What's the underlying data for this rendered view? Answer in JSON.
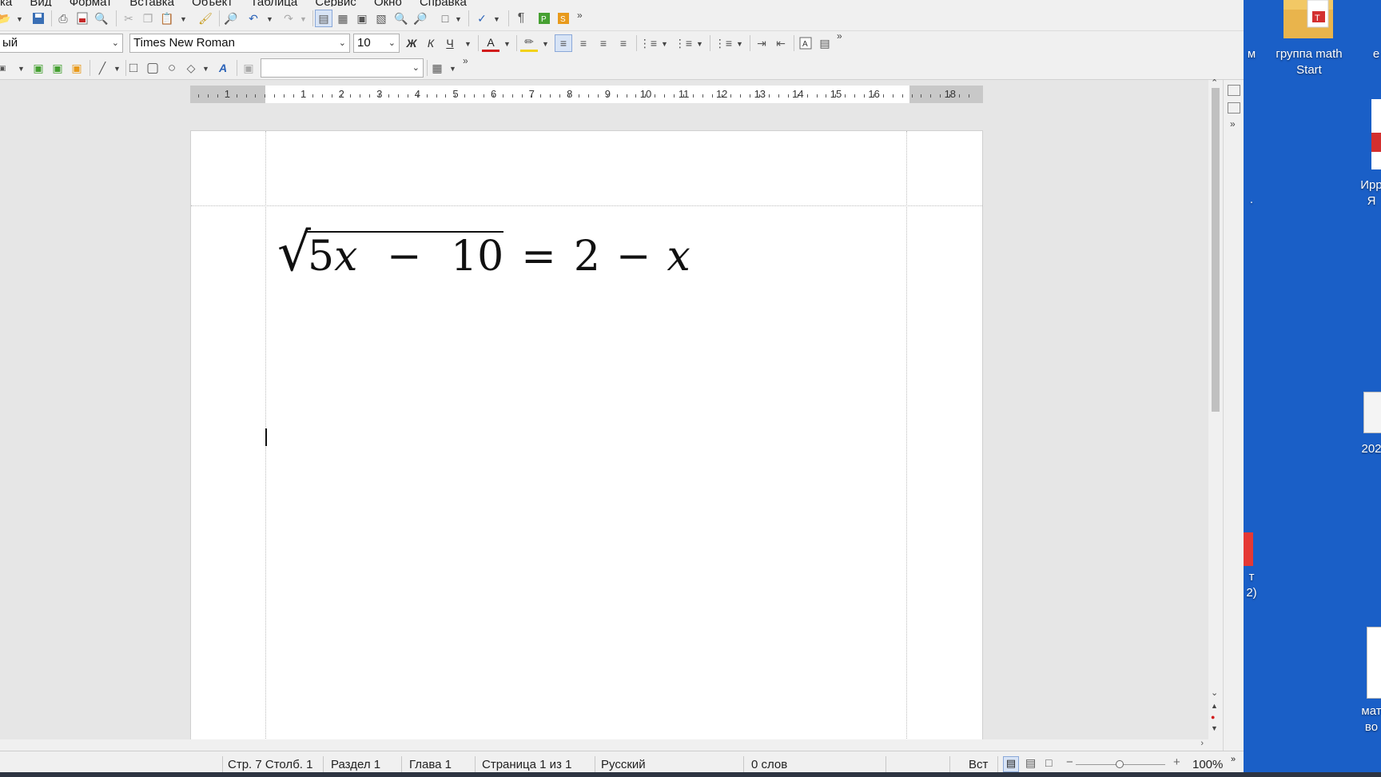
{
  "menubar": {
    "items": [
      "ка",
      "Вид",
      "Формат",
      "Вставка",
      "Объект",
      "Таблица",
      "Сервис",
      "Окно",
      "Справка"
    ]
  },
  "formatting": {
    "paragraph_style": "ый",
    "font_name": "Times New Roman",
    "font_size": "10",
    "bold_label": "Ж",
    "italic_label": "К",
    "underline_label": "Ч"
  },
  "ruler": {
    "labels": [
      "1",
      "1",
      "2",
      "3",
      "4",
      "5",
      "6",
      "7",
      "8",
      "9",
      "10",
      "11",
      "12",
      "13",
      "14",
      "15",
      "16",
      "18"
    ]
  },
  "document": {
    "formula": {
      "radicand_coef": "5",
      "radicand_var": "x",
      "radicand_op": "−",
      "radicand_const": "10",
      "equals": "=",
      "rhs_const": "2",
      "rhs_op": "−",
      "rhs_var": "x"
    }
  },
  "statusbar": {
    "position": "Стр. 7 Столб. 1",
    "section": "Раздел 1",
    "chapter": "Глава 1",
    "page": "Страница 1 из 1",
    "language": "Русский",
    "words": "0 слов",
    "insert_mode": "Вст",
    "zoom": "100%",
    "zoom_level_percent": 100
  },
  "desktop": {
    "icons": [
      {
        "label": "м"
      },
      {
        "label": "группа math Start"
      },
      {
        "label": "е"
      },
      {
        "label": "Ирр Я"
      },
      {
        "label": "."
      },
      {
        "label": "202"
      },
      {
        "label": "т 2)"
      },
      {
        "label": "мат во"
      }
    ]
  },
  "colors": {
    "desktop": "#1a5fc7",
    "toolbar_bg": "#f0f0f0",
    "selected_button": "#d8e4f6"
  }
}
